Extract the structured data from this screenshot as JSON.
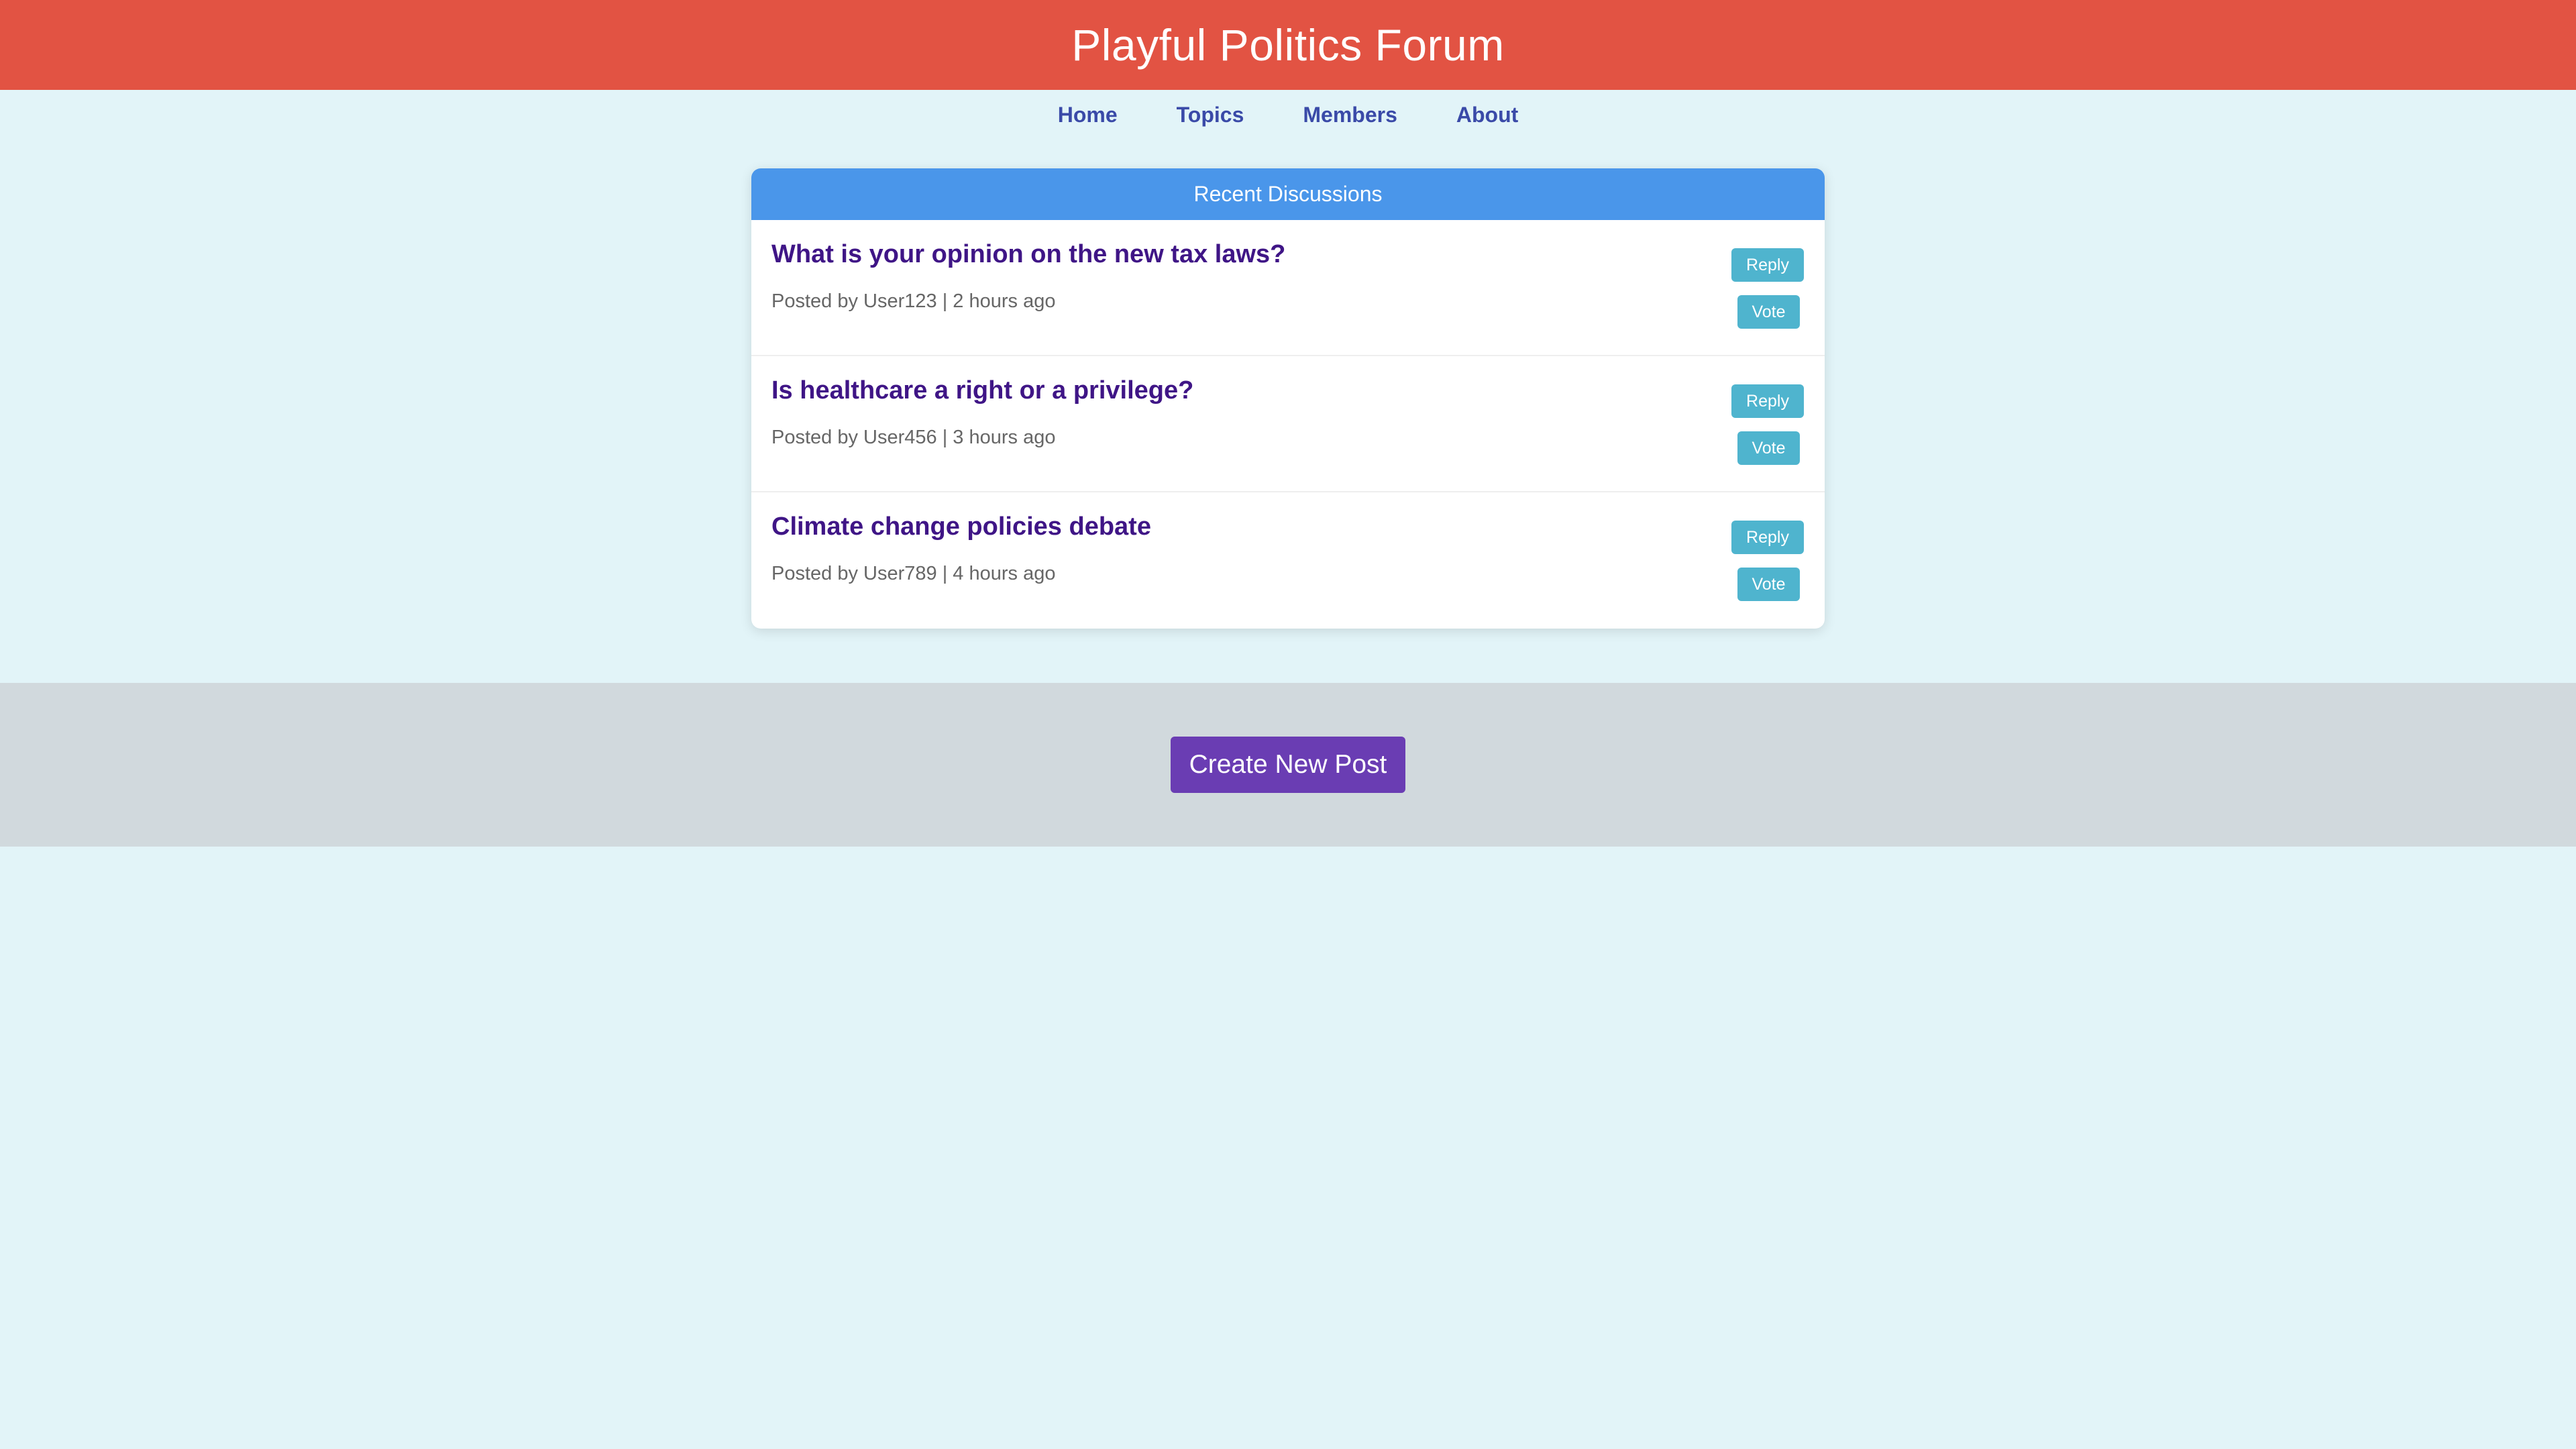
{
  "header": {
    "title": "Playful Politics Forum"
  },
  "nav": {
    "items": [
      {
        "label": "Home"
      },
      {
        "label": "Topics"
      },
      {
        "label": "Members"
      },
      {
        "label": "About"
      }
    ]
  },
  "discussions": {
    "heading": "Recent Discussions",
    "posts": [
      {
        "title": "What is your opinion on the new tax laws?",
        "meta": "Posted by User123 | 2 hours ago",
        "reply_label": "Reply",
        "vote_label": "Vote"
      },
      {
        "title": "Is healthcare a right or a privilege?",
        "meta": "Posted by User456 | 3 hours ago",
        "reply_label": "Reply",
        "vote_label": "Vote"
      },
      {
        "title": "Climate change policies debate",
        "meta": "Posted by User789 | 4 hours ago",
        "reply_label": "Reply",
        "vote_label": "Vote"
      }
    ]
  },
  "footer": {
    "create_label": "Create New Post"
  },
  "colors": {
    "header_bg": "#e25343",
    "nav_link": "#3a4aa8",
    "card_header_bg": "#4a96ea",
    "post_title": "#3f1586",
    "action_button": "#4fb4ce",
    "create_button": "#6a3db3",
    "page_bg": "#e2f4f8",
    "footer_bg": "#d1d9dd"
  }
}
